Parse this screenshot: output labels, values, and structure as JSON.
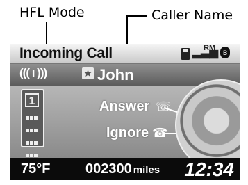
{
  "callouts": {
    "hfl_mode": "HFL Mode",
    "caller_name": "Caller Name"
  },
  "display": {
    "title": "Incoming Call",
    "status": {
      "roaming": "RM"
    },
    "caller": {
      "name": "John"
    },
    "options": {
      "answer": "Answer",
      "ignore": "Ignore"
    },
    "phone": {
      "line_number": "1"
    },
    "bottom": {
      "temperature": "75°F",
      "odometer": "002300",
      "odometer_unit": "miles",
      "clock": "12:34"
    }
  },
  "icons": {
    "ring": "ringing-waves-icon",
    "contact": "star-contact-icon",
    "phone": "cell-phone-icon",
    "answer": "answer-call-icon",
    "ignore": "hang-up-icon",
    "dial": "selector-dial-icon",
    "battery": "battery-icon",
    "signal": "signal-strength-icon",
    "bluetooth": "bluetooth-icon"
  },
  "colors": {
    "topbar": "#e0e0e0",
    "bar2": "#6f6f6f",
    "mid": "#9e9e9e",
    "bottom": "#0b0b0b",
    "text_light": "#ffffff"
  }
}
